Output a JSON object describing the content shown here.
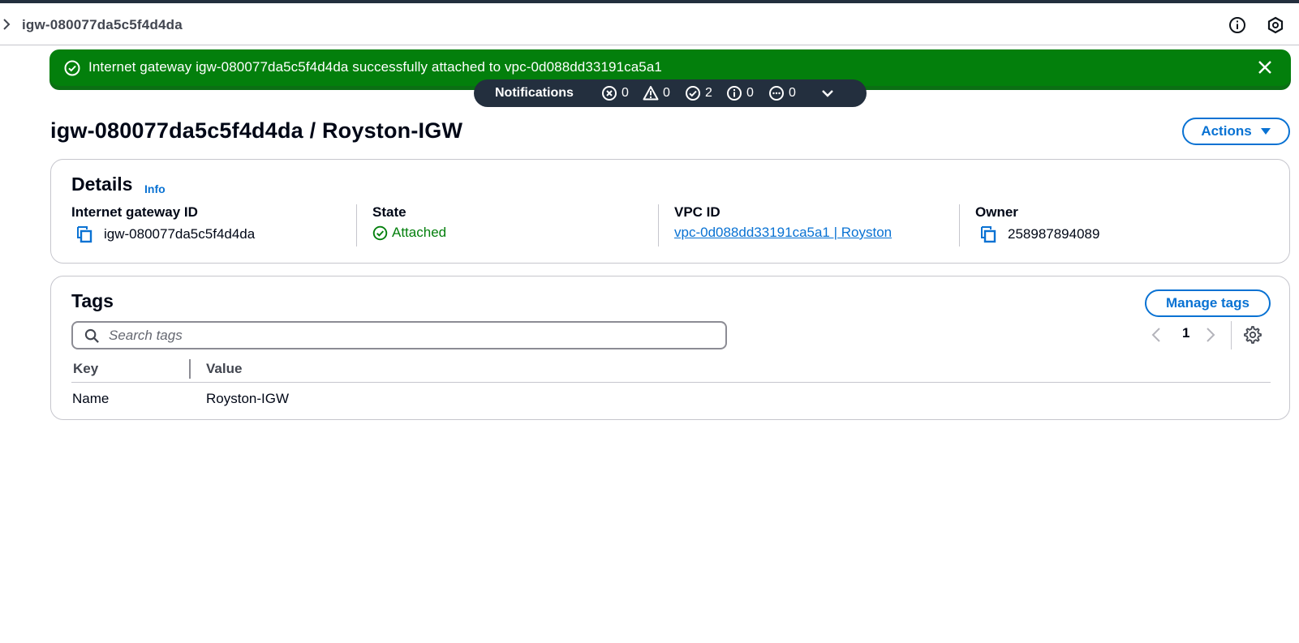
{
  "breadcrumb": {
    "current": "igw-080077da5c5f4d4da"
  },
  "flash": {
    "message": "Internet gateway igw-080077da5c5f4d4da successfully attached to vpc-0d088dd33191ca5a1",
    "type": "success",
    "color": "#037f0c"
  },
  "notifications": {
    "label": "Notifications",
    "errors": "0",
    "warnings": "0",
    "success": "2",
    "info": "0",
    "in_progress": "0"
  },
  "page": {
    "title": "igw-080077da5c5f4d4da / Royston-IGW",
    "actions_label": "Actions"
  },
  "details": {
    "title": "Details",
    "info_label": "Info",
    "columns": [
      {
        "label": "Internet gateway ID",
        "value": "igw-080077da5c5f4d4da"
      },
      {
        "label": "State",
        "value": "Attached"
      },
      {
        "label": "VPC ID",
        "value": "vpc-0d088dd33191ca5a1 | Royston"
      },
      {
        "label": "Owner",
        "value": "258987894089"
      }
    ]
  },
  "tags": {
    "title": "Tags",
    "manage_label": "Manage tags",
    "search_placeholder": "Search tags",
    "page_number": "1",
    "headers": [
      "Key",
      "Value"
    ],
    "rows": [
      {
        "key": "Name",
        "value": "Royston-IGW"
      }
    ]
  },
  "colors": {
    "accent": "#0972d3",
    "success": "#037f0c",
    "dark_bar": "#232f3e"
  }
}
